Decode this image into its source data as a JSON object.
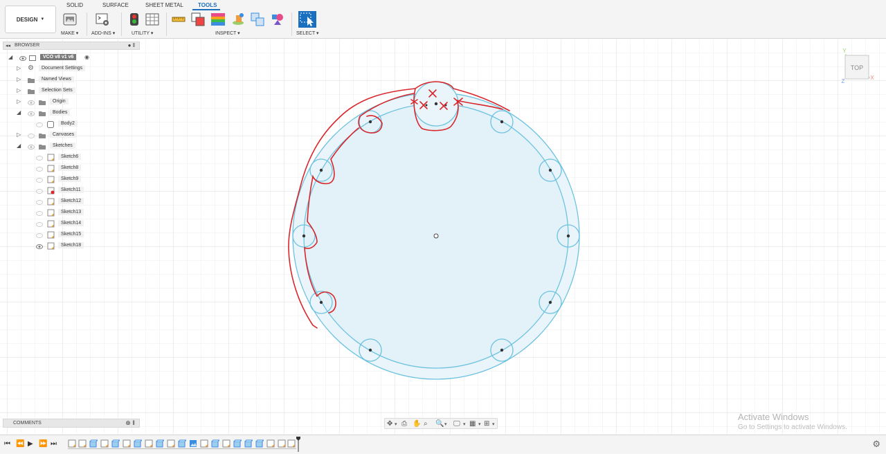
{
  "ribbon": {
    "workspace_button": "DESIGN",
    "tabs": [
      "SOLID",
      "SURFACE",
      "SHEET METAL",
      "TOOLS"
    ],
    "active_tab": "TOOLS",
    "groups": {
      "make": "MAKE",
      "addins": "ADD-INS",
      "utility": "UTILITY",
      "inspect": "INSPECT",
      "select": "SELECT"
    }
  },
  "browser": {
    "title": "BROWSER",
    "root": "VCO v8 v1 v6",
    "items": [
      {
        "label": "Document Settings",
        "icon": "gear-icon"
      },
      {
        "label": "Named Views",
        "icon": "folder-icon"
      },
      {
        "label": "Selection Sets",
        "icon": "folder-icon"
      },
      {
        "label": "Origin",
        "icon": "folder-icon"
      },
      {
        "label": "Bodies",
        "icon": "folder-icon"
      },
      {
        "label": "Body2",
        "icon": "body-icon"
      },
      {
        "label": "Canvases",
        "icon": "folder-icon"
      },
      {
        "label": "Sketches",
        "icon": "folder-icon"
      }
    ],
    "sketches": [
      "Sketch6",
      "Sketch8",
      "Sketch9",
      "Sketch11",
      "Sketch12",
      "Sketch13",
      "Sketch14",
      "Sketch15",
      "Sketch18"
    ]
  },
  "comments": {
    "title": "COMMENTS"
  },
  "viewcube": {
    "face": "TOP",
    "axis_x": "X",
    "axis_y": "Y",
    "axis_z": "Z"
  },
  "watermark": {
    "title": "Activate Windows",
    "subtitle": "Go to Settings to activate Windows."
  },
  "colors": {
    "accent": "#1a6fbf",
    "sketch_line": "#6cc2df",
    "sketch_fill": "#e6f3fa",
    "annotation": "#d8262b"
  }
}
